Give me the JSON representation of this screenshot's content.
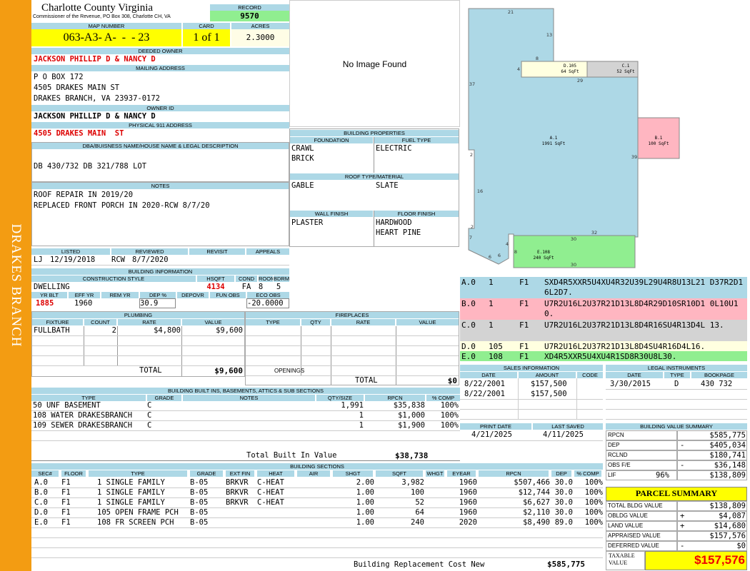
{
  "side_label": "DRAKES BRANCH",
  "header": {
    "county": "Charlotte County Virginia",
    "commissioner": "Commissioner of the Revenue, PO Box 308, Charlotte CH, VA",
    "record_label": "RECORD",
    "record": "9570",
    "map_number_label": "MAP NUMBER",
    "map_number": "063-A3- A-  -  - 23",
    "card_label": "CARD",
    "card": "1 of 1",
    "acres_label": "ACRES",
    "acres": "2.3000"
  },
  "owner": {
    "deeded_owner_label": "DEEDED OWNER",
    "deeded_owner": "JACKSON PHILLIP D & NANCY D",
    "mailing_label": "MAILING ADDRESS",
    "mailing": [
      "P O BOX 172",
      "4505 DRAKES MAIN ST",
      "DRAKES BRANCH, VA 23937-0172"
    ],
    "owner_id_label": "OWNER ID",
    "owner_id": "JACKSON PHILLIP D & NANCY D",
    "physical_label": "PHYSICAL 911 ADDRESS",
    "physical": "4505 DRAKES MAIN  ST"
  },
  "legal": {
    "label": "DBA/BUISNESS NAME/HOUSE NAME & LEGAL DESCRIPTION",
    "text": "DB 430/732 DB 321/788 LOT"
  },
  "notes": {
    "label": "NOTES",
    "lines": [
      "ROOF REPAIR IN 2019/20",
      "REPLACED FRONT PORCH IN 2020-RCW 8/7/20"
    ]
  },
  "listing": {
    "listed_label": "LISTED",
    "reviewed_label": "REVIEWED",
    "revisit_label": "REVISIT",
    "appeals_label": "APPEALS",
    "listed_by": "LJ",
    "listed_date": "12/19/2018",
    "reviewed_by": "RCW",
    "reviewed_date": "8/7/2020"
  },
  "building_info": {
    "label": "BUILDING INFORMATION",
    "cs_label": "CONSTRUCTION STYLE",
    "hsqft_label": "HSQFT",
    "cond_label": "COND",
    "rooms_label": "ROOMS",
    "bdrms_label": "BDRMS",
    "style": "DWELLING",
    "hsqft": "4134",
    "cond": "FA",
    "rooms": "8",
    "bdrms": "5",
    "yrblt_label": "YR BLT",
    "effyr_label": "EFF YR",
    "remyr_label": "REM YR",
    "dep_label": "DEP %",
    "depovr_label": "DEPOVR",
    "funobs_label": "FUN OBS",
    "ecoobs_label": "ECO OBS",
    "yrblt": "1885",
    "effyr": "1960",
    "remyr": "",
    "dep": "30.9",
    "depovr": "",
    "funobs": "",
    "ecoobs": "-20.0000"
  },
  "image_placeholder": "No Image Found",
  "building_props": {
    "label": "BUILDING PROPERTIES",
    "foundation_label": "FOUNDATION",
    "fuel_label": "FUEL TYPE",
    "foundation": [
      "CRAWL",
      "BRICK"
    ],
    "fuel": "ELECTRIC",
    "roof_label": "ROOF TYPE/MATERIAL",
    "roof_type": "GABLE",
    "roof_material": "SLATE",
    "wall_label": "WALL FINISH",
    "floor_label": "FLOOR FINISH",
    "wall": "PLASTER",
    "floor": [
      "HARDWOOD",
      "HEART PINE"
    ]
  },
  "plumbing": {
    "label": "PLUMBING",
    "cols": [
      "FIXTURE",
      "COUNT",
      "RATE",
      "VALUE"
    ],
    "rows": [
      {
        "fixture": "FULLBATH",
        "count": "2",
        "rate": "$4,800",
        "value": "$9,600"
      }
    ],
    "total_label": "TOTAL",
    "total": "$9,600"
  },
  "fireplaces": {
    "label": "FIREPLACES",
    "cols": [
      "TYPE",
      "QTY",
      "RATE",
      "VALUE"
    ],
    "openings_label": "OPENINGS",
    "total_label": "TOTAL",
    "total": "$0"
  },
  "builtins": {
    "label": "BUILDING BUILT INS, BASEMENTS, ATTICS & SUB SECTIONS",
    "cols": [
      "TYPE",
      "GRADE",
      "NOTES",
      "QTY/SIZE",
      "RPCN",
      "% COMP"
    ],
    "rows": [
      {
        "type": "50 UNF BASEMENT",
        "grade": "C",
        "qty": "1,991",
        "rpcn": "$35,838",
        "comp": "100%"
      },
      {
        "type": "108 WATER DRAKESBRANCH",
        "grade": "C",
        "qty": "1",
        "rpcn": "$1,000",
        "comp": "100%"
      },
      {
        "type": "109 SEWER DRAKESBRANCH",
        "grade": "C",
        "qty": "1",
        "rpcn": "$1,900",
        "comp": "100%"
      }
    ],
    "total_label": "Total Built In Value",
    "total": "$38,738"
  },
  "sections": {
    "label": "BUILDING SECTIONS",
    "cols": [
      "SEC#",
      "FLOOR",
      "TYPE",
      "GRADE",
      "EXT FIN",
      "HEAT",
      "AIR",
      "SHGT",
      "SQFT",
      "WHGT",
      "EYEAR",
      "RPCN",
      "DEP",
      "% COMP"
    ],
    "rows": [
      {
        "sec": "A.0",
        "floor": "F1",
        "type": "1 SINGLE FAMILY",
        "grade": "B-05",
        "ext": "BRKVR",
        "heat": "C-HEAT",
        "air": "",
        "shgt": "2.00",
        "sqft": "3,982",
        "whgt": "",
        "eyear": "1960",
        "rpcn": "$507,466",
        "dep": "30.0",
        "comp": "100%"
      },
      {
        "sec": "B.0",
        "floor": "F1",
        "type": "1 SINGLE FAMILY",
        "grade": "B-05",
        "ext": "BRKVR",
        "heat": "C-HEAT",
        "air": "",
        "shgt": "1.00",
        "sqft": "100",
        "whgt": "",
        "eyear": "1960",
        "rpcn": "$12,744",
        "dep": "30.0",
        "comp": "100%"
      },
      {
        "sec": "C.0",
        "floor": "F1",
        "type": "1 SINGLE FAMILY",
        "grade": "B-05",
        "ext": "BRKVR",
        "heat": "C-HEAT",
        "air": "",
        "shgt": "1.00",
        "sqft": "52",
        "whgt": "",
        "eyear": "1960",
        "rpcn": "$6,627",
        "dep": "30.0",
        "comp": "100%"
      },
      {
        "sec": "D.0",
        "floor": "F1",
        "type": "105 OPEN FRAME PCH",
        "grade": "B-05",
        "ext": "",
        "heat": "",
        "air": "",
        "shgt": "1.00",
        "sqft": "64",
        "whgt": "",
        "eyear": "1960",
        "rpcn": "$2,110",
        "dep": "30.0",
        "comp": "100%"
      },
      {
        "sec": "E.0",
        "floor": "F1",
        "type": "108 FR SCREEN PCH",
        "grade": "B-05",
        "ext": "",
        "heat": "",
        "air": "",
        "shgt": "1.00",
        "sqft": "240",
        "whgt": "",
        "eyear": "2020",
        "rpcn": "$8,490",
        "dep": "89.0",
        "comp": "100%"
      }
    ],
    "brcn_label": "Building Replacement Cost New",
    "brcn": "$585,775"
  },
  "sketch": {
    "labels": [
      {
        "code": "D.105",
        "area": "64 SqFt"
      },
      {
        "code": "C.1",
        "area": "52 SqFt"
      },
      {
        "code": "A.1",
        "area": "1991 SqFt"
      },
      {
        "code": "B.1",
        "area": "100 SqFt"
      },
      {
        "code": "E.108",
        "area": "240 SqFt"
      }
    ],
    "dims": [
      "21",
      "13",
      "8",
      "4",
      "29",
      "37",
      "2",
      "39",
      "16",
      "2",
      "7",
      "6",
      "6",
      "4",
      "32",
      "8",
      "30",
      "30"
    ],
    "colors": {
      "a": "#add8e6",
      "b": "#ffb6c1",
      "c": "#d3d3d3",
      "d": "#ffffe0",
      "e": "#90ee90"
    }
  },
  "vectors": [
    {
      "sec": "A.0",
      "n": "1",
      "f": "F1",
      "text": "SXD4R5XXR5U4XU4R32U39L29U4R8U13L21 D37R2D16L2D7.",
      "color": "#add8e6"
    },
    {
      "sec": "B.0",
      "n": "1",
      "f": "F1",
      "text": "U7R2U16L2U37R21D13L8D4R29D10SR10D1 0L10U10.",
      "color": "#ffb6c1"
    },
    {
      "sec": "C.0",
      "n": "1",
      "f": "F1",
      "text": "U7R2U16L2U37R21D13L8D4R16SU4R13D4L 13.",
      "color": "#d3d3d3"
    },
    {
      "sec": "D.0",
      "n": "105",
      "f": "F1",
      "text": "U7R2U16L2U37R21D13L8D4SU4R16D4L16.",
      "color": "#ffffe0"
    },
    {
      "sec": "E.0",
      "n": "108",
      "f": "F1",
      "text": "XD4R5XXR5U4XU4R1SD8R30U8L30.",
      "color": "#90ee90"
    }
  ],
  "sales": {
    "label": "SALES INFORMATION",
    "cols": [
      "DATE",
      "AMOUNT",
      "CODE"
    ],
    "rows": [
      {
        "date": "8/22/2001",
        "amount": "$157,500"
      },
      {
        "date": "8/22/2001",
        "amount": "$157,500"
      }
    ]
  },
  "legal_instruments": {
    "label": "LEGAL INSTRUMENTS",
    "cols": [
      "DATE",
      "TYPE",
      "BOOKPAGE"
    ],
    "rows": [
      {
        "date": "3/30/2015",
        "type": "D",
        "bookpage": "430 732"
      }
    ]
  },
  "dates": {
    "print_label": "PRINT DATE",
    "print": "4/21/2025",
    "saved_label": "LAST SAVED",
    "saved": "4/11/2025"
  },
  "bvs": {
    "label": "BUILDING VALUE SUMMARY",
    "rows": [
      {
        "label": "RPCN",
        "sign": "",
        "value": "$585,775"
      },
      {
        "label": "DEP",
        "sign": "-",
        "value": "$405,034"
      },
      {
        "label": "RCLND",
        "sign": "",
        "value": "$180,741"
      },
      {
        "label": "OBS F/E",
        "sign": "-",
        "value": "$36,148"
      },
      {
        "label": "LIF",
        "extra": "96%",
        "sign": "",
        "value": "$138,809"
      }
    ]
  },
  "parcel": {
    "label": "PARCEL SUMMARY",
    "rows": [
      {
        "label": "TOTAL BLDG VALUE",
        "sign": "",
        "value": "$138,809"
      },
      {
        "label": "OBLDG VALUE",
        "sign": "+",
        "value": "$4,087"
      },
      {
        "label": "LAND VALUE",
        "sign": "+",
        "value": "$14,680"
      },
      {
        "label": "APPRAISED VALUE",
        "sign": "",
        "value": "$157,576"
      },
      {
        "label": "DEFERRED VALUE",
        "sign": "-",
        "value": "$0"
      }
    ],
    "taxable_label": "TAXABLE VALUE",
    "taxable": "$157,576"
  }
}
